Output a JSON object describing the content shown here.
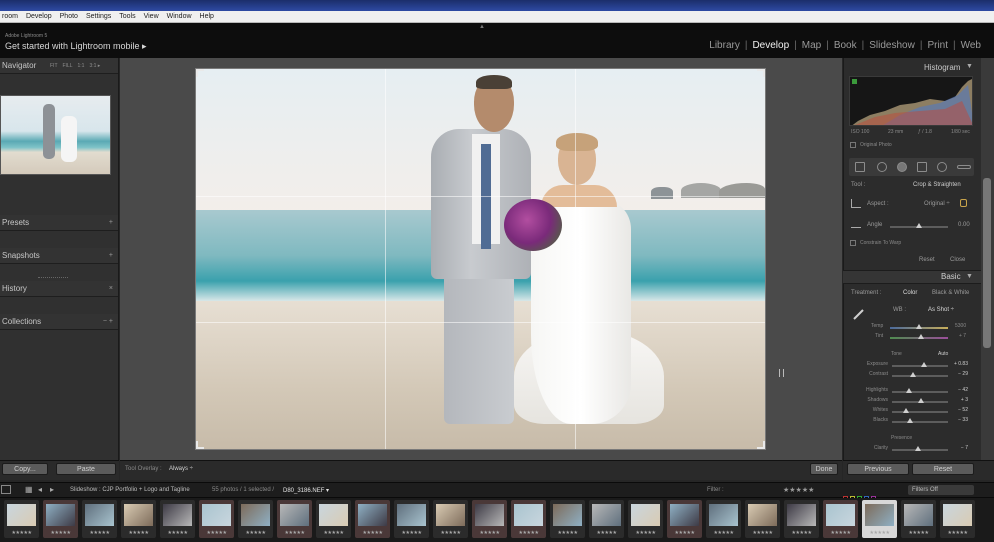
{
  "os": {
    "menu": [
      "room",
      "Develop",
      "Photo",
      "Settings",
      "Tools",
      "View",
      "Window",
      "Help"
    ]
  },
  "header": {
    "brand_small": "Adobe Lightroom 5",
    "brand_main": "Get started with Lightroom mobile ▸",
    "modules": [
      "Library",
      "Develop",
      "Map",
      "Book",
      "Slideshow",
      "Print",
      "Web"
    ],
    "active_module": "Develop"
  },
  "left_panel": {
    "navigator": {
      "label": "Navigator",
      "sizes": [
        "FIT",
        "FILL",
        "1:1",
        "3:1 ▸"
      ]
    },
    "sections": [
      {
        "label": "Presets",
        "control": "+"
      },
      {
        "label": "Snapshots",
        "control": "+"
      },
      {
        "label": "History",
        "control": "×"
      },
      {
        "label": "Collections",
        "control": "−  +"
      }
    ],
    "copy_label": "Copy...",
    "paste_label": "Paste"
  },
  "toolbar": {
    "overlay_label": "Tool Overlay :",
    "overlay_value": "Always ÷",
    "done_label": "Done"
  },
  "right_panel": {
    "histogram_label": "Histogram",
    "exif": [
      "ISO 100",
      "23 mm",
      "ƒ / 1.8",
      "1/80 sec"
    ],
    "original_photo": "Original Photo",
    "crop": {
      "tool_label": "Tool :",
      "tool_value": "Crop & Straighten",
      "aspect_label": "Aspect :",
      "aspect_value": "Original ÷",
      "angle_label": "Angle",
      "angle_value": "0.00",
      "constrain_label": "Constrain To Warp",
      "reset_label": "Reset",
      "close_label": "Close"
    },
    "basic": {
      "label": "Basic",
      "treatment_label": "Treatment :",
      "color_label": "Color",
      "bw_label": "Black & White",
      "wb_label": "WB :",
      "wb_value": "As Shot ÷",
      "temp_label": "Temp",
      "temp_value": "5300",
      "tint_label": "Tint",
      "tint_value": "+ 7",
      "tone_label": "Tone",
      "auto_label": "Auto",
      "presence_label": "Presence",
      "sliders": [
        {
          "label": "Exposure",
          "value": "+ 0.83",
          "level": 0.58
        },
        {
          "label": "Contrast",
          "value": "− 29",
          "level": 0.38
        },
        {
          "label": "Highlights",
          "value": "− 42",
          "level": 0.3
        },
        {
          "label": "Shadows",
          "value": "+ 3",
          "level": 0.51
        },
        {
          "label": "Whites",
          "value": "− 52",
          "level": 0.25
        },
        {
          "label": "Blacks",
          "value": "− 33",
          "level": 0.33
        },
        {
          "label": "Clarity",
          "value": "− 7",
          "level": 0.47
        }
      ]
    },
    "previous_label": "Previous",
    "reset_label": "Reset"
  },
  "filmstrip": {
    "source": "Slideshow : CJP Portfolio + Logo and Tagline",
    "count": "55 photos / 1 selected /",
    "filename": "D80_3186.NEF ▾",
    "filter_label": "Filter :",
    "filters_off": "Filters Off",
    "stars_text": "★★★★★",
    "thumbnail_count": 25
  },
  "colors": {
    "bg": "#262626",
    "panel": "#2c2c2c",
    "accent": "#f2f2f2"
  }
}
